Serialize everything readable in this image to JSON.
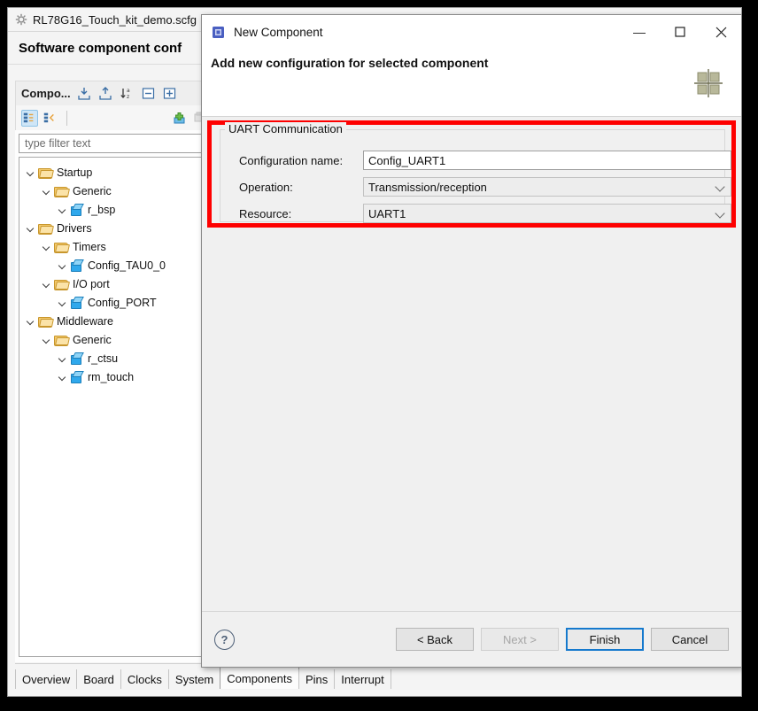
{
  "app": {
    "title": "RL78G16_Touch_kit_demo.scfg",
    "title_icon": "gear-icon",
    "heading": "Software component conf",
    "panel": {
      "title": "Compo...",
      "header_icons": [
        "import-icon",
        "export-icon",
        "sort-az-icon",
        "collapse-all-icon",
        "expand-all-icon"
      ],
      "toolbar_icons": [
        "show-hardware-view-icon",
        "show-software-view-icon",
        "add-component-icon",
        "remove-component-icon"
      ],
      "filter_placeholder": "type filter text",
      "filter_value": ""
    },
    "tree": [
      {
        "label": "Startup",
        "icon": "folder-icon",
        "depth": 0,
        "expander": true
      },
      {
        "label": "Generic",
        "icon": "folder-icon",
        "depth": 1,
        "expander": true
      },
      {
        "label": "r_bsp",
        "icon": "component-cube-icon",
        "depth": 2,
        "expander": false
      },
      {
        "label": "Drivers",
        "icon": "folder-icon",
        "depth": 0,
        "expander": true
      },
      {
        "label": "Timers",
        "icon": "folder-icon",
        "depth": 1,
        "expander": true
      },
      {
        "label": "Config_TAU0_0",
        "icon": "component-cube-icon",
        "depth": 2,
        "expander": false
      },
      {
        "label": "I/O port",
        "icon": "folder-icon",
        "depth": 1,
        "expander": true
      },
      {
        "label": "Config_PORT",
        "icon": "component-cube-icon",
        "depth": 2,
        "expander": false
      },
      {
        "label": "Middleware",
        "icon": "folder-icon",
        "depth": 0,
        "expander": true
      },
      {
        "label": "Generic",
        "icon": "folder-icon",
        "depth": 1,
        "expander": true
      },
      {
        "label": "r_ctsu",
        "icon": "component-cube-icon",
        "depth": 2,
        "expander": false
      },
      {
        "label": "rm_touch",
        "icon": "component-cube-icon",
        "depth": 2,
        "expander": false
      }
    ],
    "tabs": [
      {
        "label": "Overview",
        "active": false
      },
      {
        "label": "Board",
        "active": false
      },
      {
        "label": "Clocks",
        "active": false
      },
      {
        "label": "System",
        "active": false
      },
      {
        "label": "Components",
        "active": true
      },
      {
        "label": "Pins",
        "active": false
      },
      {
        "label": "Interrupt",
        "active": false
      }
    ]
  },
  "dialog": {
    "title": "New Component",
    "title_icon": "component-chip-icon",
    "subheading": "Add new configuration for selected component",
    "subheading_icon": "chip-graphic-icon",
    "window_buttons": {
      "minimize": "—",
      "maximize": "☐",
      "close": "✕"
    },
    "group": {
      "label": "UART Communication",
      "fields": [
        {
          "label": "Configuration name:",
          "value": "Config_UART1",
          "type": "text"
        },
        {
          "label": "Operation:",
          "value": "Transmission/reception",
          "type": "combo"
        },
        {
          "label": "Resource:",
          "value": "UART1",
          "type": "combo"
        }
      ]
    },
    "footer": {
      "help_icon": "help-icon",
      "help_glyph": "?",
      "buttons": [
        {
          "label": "< Back",
          "state": "enabled"
        },
        {
          "label": "Next >",
          "state": "disabled"
        },
        {
          "label": "Finish",
          "state": "focused"
        },
        {
          "label": "Cancel",
          "state": "enabled"
        }
      ]
    }
  },
  "colors": {
    "annotation_red": "#fe0000",
    "focus_blue": "#1579cd",
    "dialog_bg": "#f0f0f0"
  }
}
